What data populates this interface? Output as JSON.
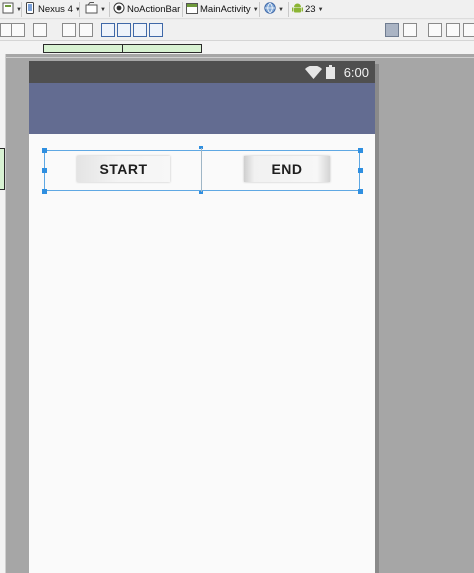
{
  "toolbar": {
    "device_label": "Nexus 4",
    "theme_label": "NoActionBar",
    "activity_label": "MainActivity",
    "api_label": "23"
  },
  "status_bar": {
    "time": "6:00"
  },
  "layout": {
    "start_button_label": "START",
    "end_button_label": "END"
  },
  "colors": {
    "action_bar": "#636c91",
    "status_bar": "#4f4f4f",
    "selection": "#5fa8e3"
  }
}
